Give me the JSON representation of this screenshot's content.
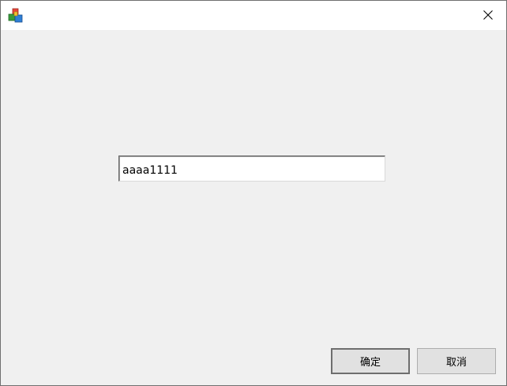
{
  "window": {
    "app_icon": "colored-blocks-icon",
    "close_icon": "close-icon"
  },
  "input": {
    "value": "aaaa1111"
  },
  "buttons": {
    "ok_label": "确定",
    "cancel_label": "取消"
  }
}
